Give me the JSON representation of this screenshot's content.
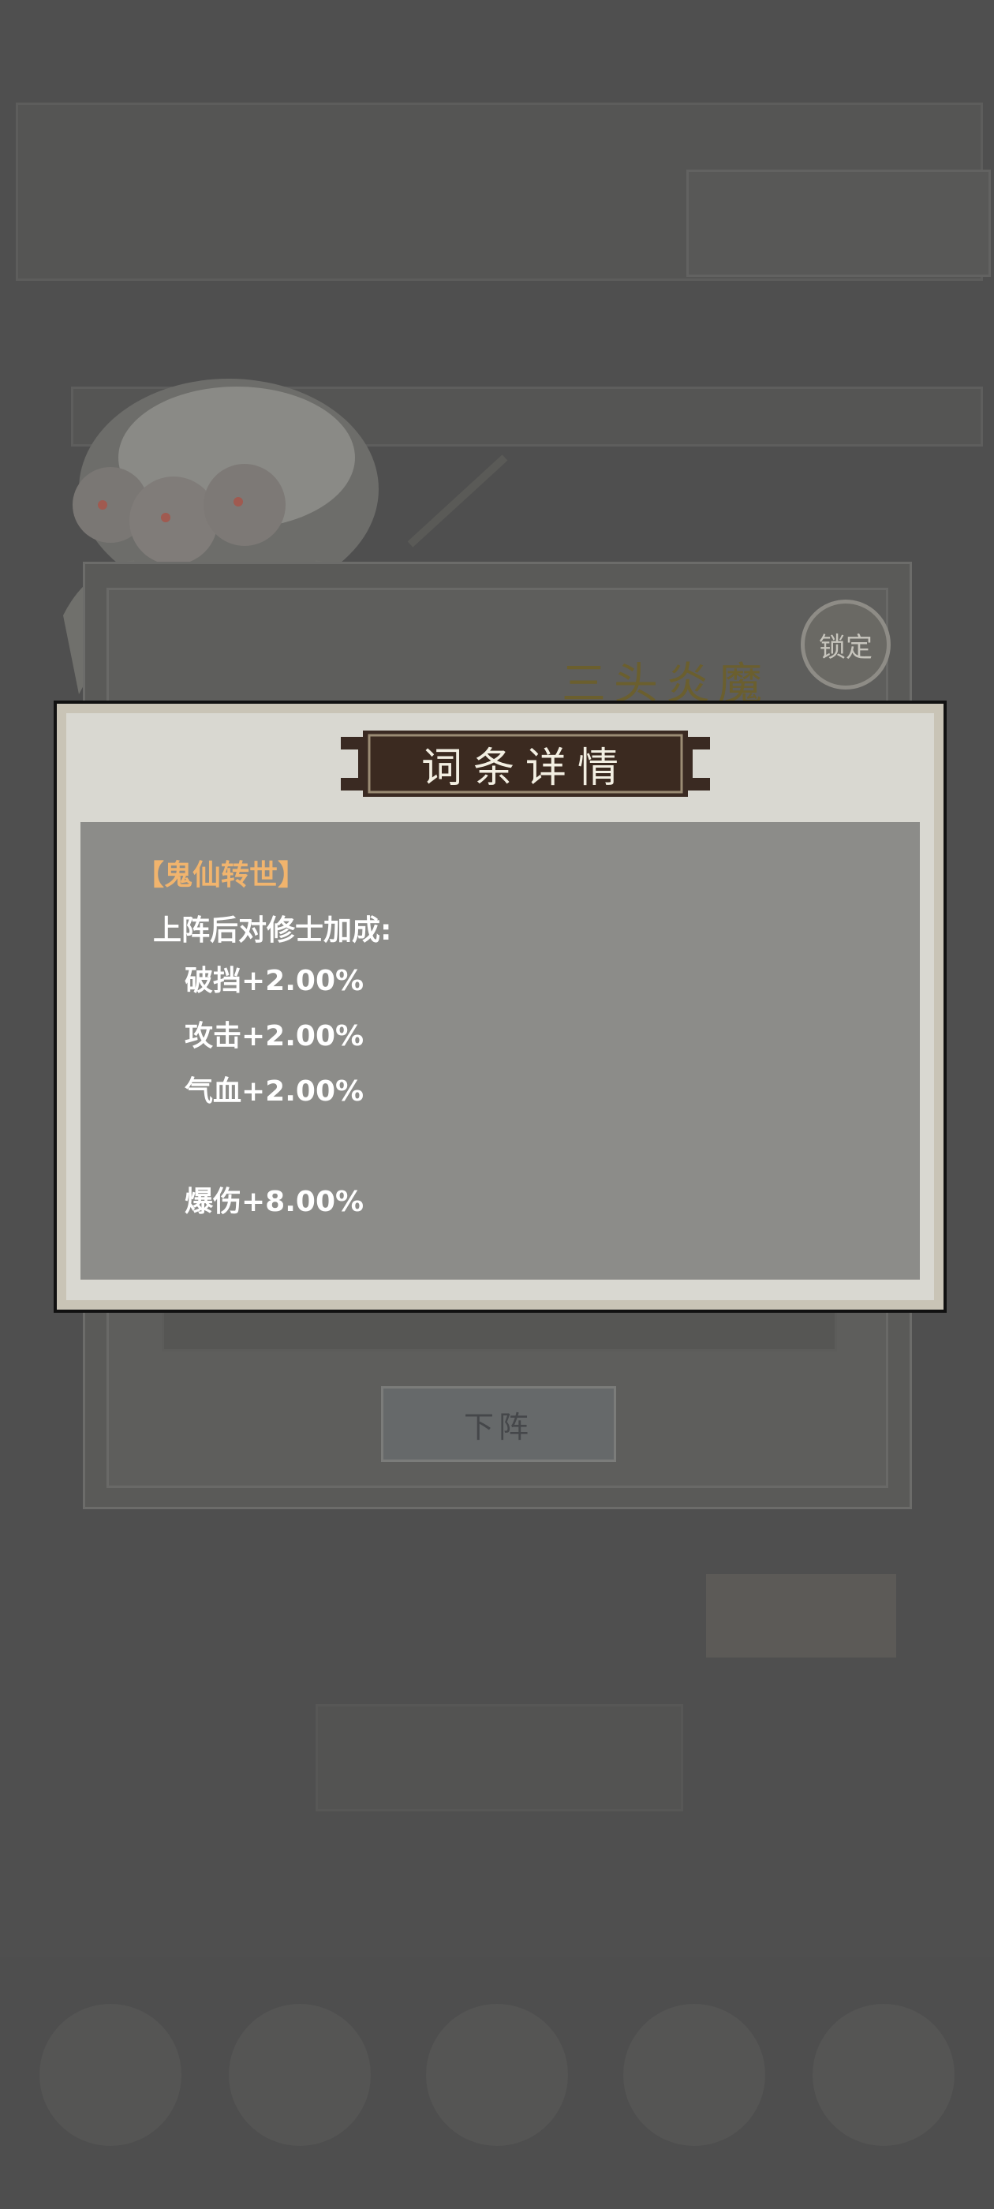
{
  "background": {
    "lock_label": "锁定",
    "creature_name": "三头炎魔",
    "dismiss_button": "下阵"
  },
  "modal": {
    "title": "词条详情",
    "affix_name": "【鬼仙转世】",
    "intro": "上阵后对修士加成:",
    "stats": [
      "破挡+2.00%",
      "攻击+2.00%",
      "气血+2.00%",
      "",
      "爆伤+8.00%"
    ]
  },
  "colors": {
    "overlay": "#4f4f4f",
    "modal_frame": "#d9d8d1",
    "modal_body": "#8c8c89",
    "affix_title": "#f1b46d",
    "header_plate": "#3a2a22"
  }
}
